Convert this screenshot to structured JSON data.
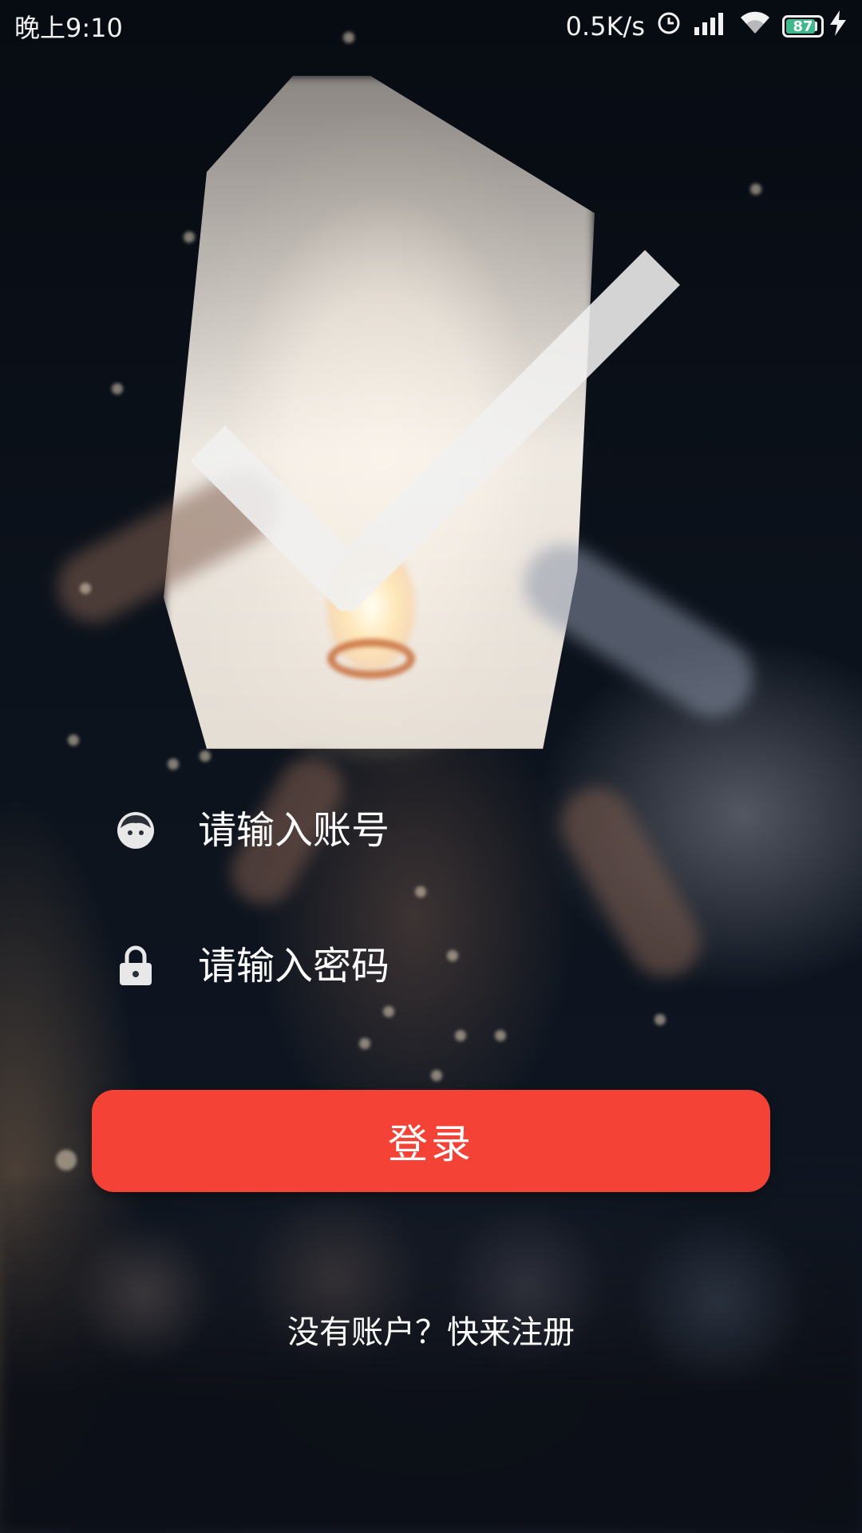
{
  "status_bar": {
    "time": "晚上9:10",
    "network_speed": "0.5K/s",
    "battery_level": "87",
    "battery_percent": 87,
    "icons": [
      "alarm-icon",
      "signal-icon",
      "wifi-icon",
      "battery-icon",
      "charging-icon"
    ]
  },
  "login": {
    "account_placeholder": "请输入账号",
    "password_placeholder": "请输入密码",
    "login_button_label": "登录",
    "register_link": "没有账户？快来注册"
  },
  "colors": {
    "primary_button": "#f44236",
    "battery_fill": "#3fb88d",
    "text": "#ffffff"
  }
}
